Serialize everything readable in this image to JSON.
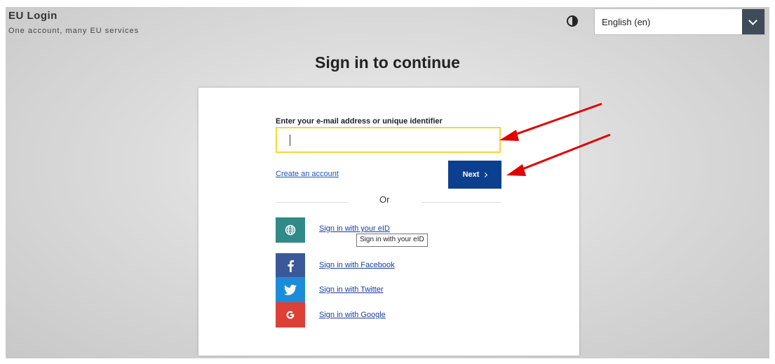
{
  "header": {
    "app_title": "EU Login",
    "app_subtitle": "One account, many EU services",
    "contrast_icon": "contrast-icon",
    "language": "English (en)"
  },
  "main": {
    "heading": "Sign in to continue",
    "field_label": "Enter your e-mail address or unique identifier",
    "email_value": "",
    "create_account": "Create an account",
    "next_label": "Next",
    "or_label": "Or",
    "providers": [
      {
        "label": "Sign in with your eID",
        "icon": "globe-icon",
        "color": "#308a88"
      },
      {
        "label": "Sign in with Facebook",
        "icon": "facebook-icon",
        "color": "#3b5998"
      },
      {
        "label": "Sign in with Twitter",
        "icon": "twitter-icon",
        "color": "#1b8dd8"
      },
      {
        "label": "Sign in with Google",
        "icon": "google-icon",
        "color": "#dc4036"
      }
    ],
    "tooltip": "Sign in with your eID"
  },
  "colors": {
    "primary_button": "#0d3f8f",
    "input_focus": "#f5d63d",
    "link": "#1a56b8",
    "annotation_arrow": "#e00000"
  }
}
